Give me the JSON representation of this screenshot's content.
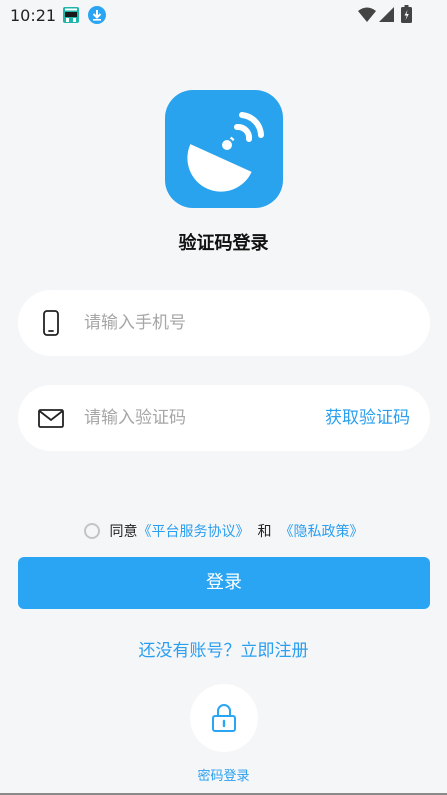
{
  "status_bar": {
    "time": "10:21"
  },
  "header": {
    "title": "验证码登录"
  },
  "form": {
    "phone_placeholder": "请输入手机号",
    "code_placeholder": "请输入验证码",
    "get_code_label": "获取验证码"
  },
  "agreement": {
    "prefix": "同意",
    "terms": "《平台服务协议》",
    "and": "和",
    "privacy": "《隐私政策》"
  },
  "login_button": "登录",
  "register_link": "还没有账号？立即注册",
  "alt_login": {
    "label": "密码登录",
    "icon": "lock-icon"
  },
  "colors": {
    "accent": "#2aa5f4",
    "background": "#f5f6f8",
    "logo": "#2aa3ef"
  }
}
